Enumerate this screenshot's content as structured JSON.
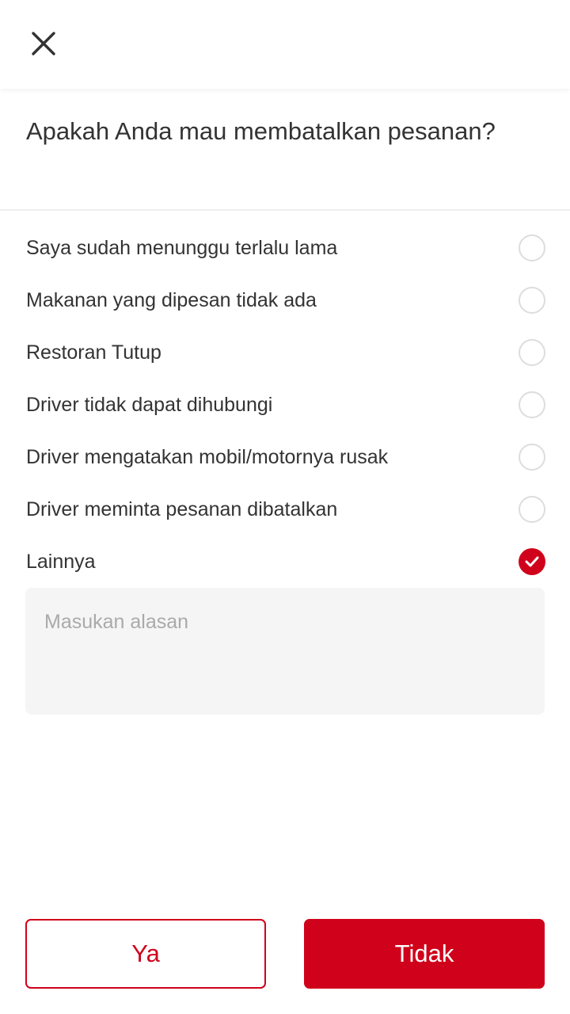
{
  "header": {
    "close_icon": "close-icon"
  },
  "dialog": {
    "title": "Apakah Anda mau membatalkan pesanan?"
  },
  "reasons": [
    {
      "label": "Saya sudah menunggu terlalu lama",
      "selected": false
    },
    {
      "label": "Makanan yang dipesan tidak ada",
      "selected": false
    },
    {
      "label": "Restoran Tutup",
      "selected": false
    },
    {
      "label": "Driver tidak dapat dihubungi",
      "selected": false
    },
    {
      "label": "Driver mengatakan mobil/motornya rusak",
      "selected": false
    },
    {
      "label": "Driver meminta pesanan dibatalkan",
      "selected": false
    },
    {
      "label": "Lainnya",
      "selected": true
    }
  ],
  "other_reason": {
    "placeholder": "Masukan alasan",
    "value": ""
  },
  "actions": {
    "yes_label": "Ya",
    "no_label": "Tidak"
  },
  "colors": {
    "accent": "#d0021b",
    "text": "#333333",
    "placeholder": "#aaaaaa",
    "input_bg": "#f5f5f5"
  }
}
